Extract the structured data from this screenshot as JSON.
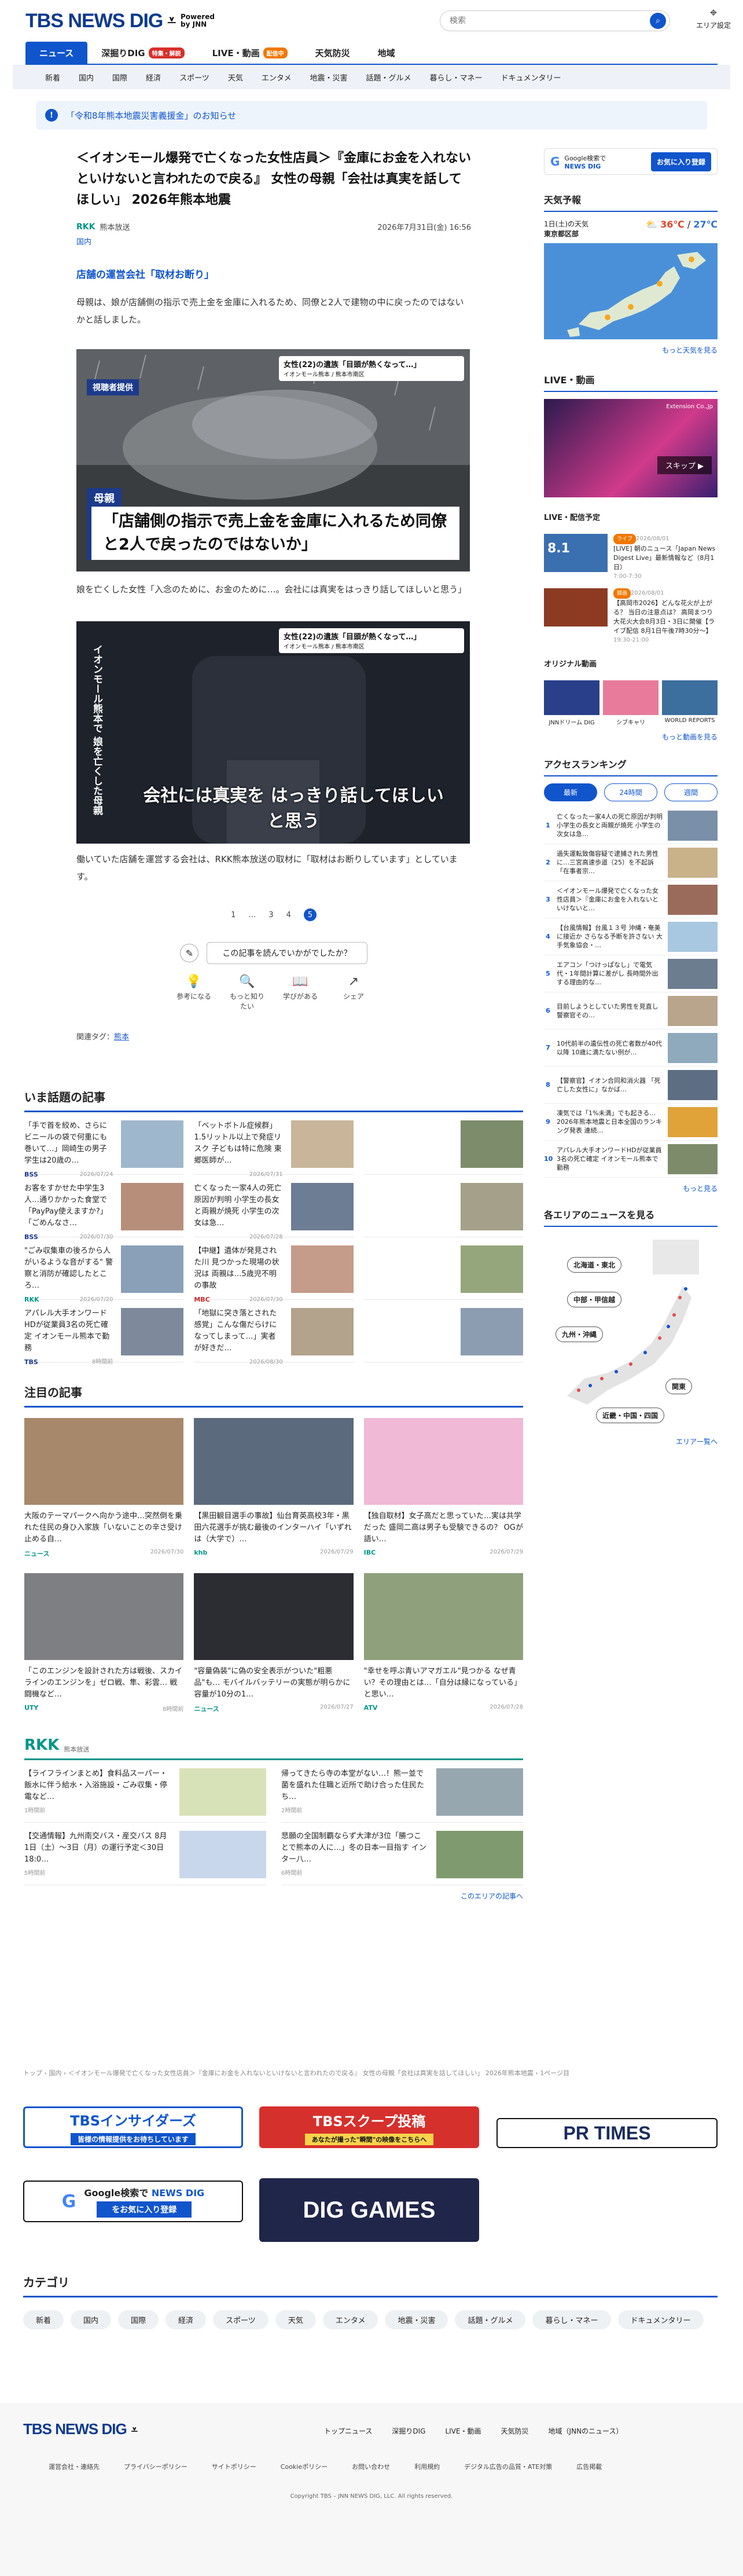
{
  "header": {
    "logo": "TBS NEWS DIG",
    "logo_powered": "Powered",
    "logo_by": "by JNN",
    "search_placeholder": "検索",
    "area_label": "エリア設定"
  },
  "gnav": [
    {
      "label": "ニュース",
      "badge": ""
    },
    {
      "label": "深掘りDIG",
      "badge": "特集・解説"
    },
    {
      "label": "LIVE・動画",
      "badge": "配信中"
    },
    {
      "label": "天気防災",
      "badge": ""
    },
    {
      "label": "地域",
      "badge": ""
    }
  ],
  "subnav": [
    "新着",
    "国内",
    "国際",
    "経済",
    "スポーツ",
    "天気",
    "エンタメ",
    "地震・災害",
    "話題・グルメ",
    "暮らし・マネー",
    "ドキュメンタリー"
  ],
  "alert": {
    "icon": "!",
    "text": "「令和8年熊本地震災害義援金」のお知らせ"
  },
  "article": {
    "title": "＜イオンモール爆発で亡くなった女性店員＞『金庫にお金を入れないといけないと言われたので戻る』 女性の母親「会社は真実を話してほしい」 2026年熊本地震",
    "source": "熊本放送",
    "source_logo": "RKK",
    "date": "2026年7月31日(金) 16:56",
    "category": "国内",
    "lead": "店舗の運営会社「取材お断り」",
    "p1": "母親は、娘が店舗側の指示で売上金を金庫に入れるため、同僚と2人で建物の中に戻ったのではないかと話しました。",
    "photo1": {
      "caption": "女性(22)の遺族「目頭が熱くなって…」",
      "caption_sub": "イオンモール熊本 / 熊本市南区",
      "tag": "視聴者提供",
      "tel": "母親",
      "band": "「店舗側の指示で売上金を金庫に入れるため同僚と2人で戻ったのではないか」"
    },
    "p2": "娘を亡くした女性「入念のために、お金のために…。会社には真実をはっきり話してほしいと思う」",
    "photo2": {
      "caption": "女性(22)の遺族「目頭が熱くなって…」",
      "caption_sub": "イオンモール熊本 / 熊本市南区",
      "vert": "イオンモール熊本で 娘を亡くした母親",
      "sub": "会社には真実を はっきり話してほしいと思う"
    },
    "p3": "働いていた店舗を運営する会社は、RKK熊本放送の取材に「取材はお断りしています」としています。",
    "pager": [
      "1",
      "…",
      "3",
      "4",
      "5"
    ],
    "react_q": "この記事を読んでいかがでしたか？",
    "reacts": [
      {
        "icon": "💡",
        "label": "参考になる"
      },
      {
        "icon": "🔍",
        "label": "もっと知りたい"
      },
      {
        "icon": "📖",
        "label": "学びがある"
      },
      {
        "icon": "↗",
        "label": "シェア"
      }
    ],
    "tags_label": "関連タグ：",
    "tag": "熊本"
  },
  "hot": {
    "title": "いま話題の記事",
    "items": [
      {
        "text": "「手で首を絞め、さらにビニールの袋で何重にも巻いて…」岡崎生の男子学生は20歳の…",
        "src": "BSS",
        "time": "2026/07/24"
      },
      {
        "text": "「ベットボトル症候群」1.5リットル以上で発症リスク 子どもは特に危険 東郷医師が…",
        "src": "",
        "time": "2026/07/31"
      },
      {
        "text": "",
        "src": "",
        "time": ""
      },
      {
        "text": "お客をすかせた中学生3人…通りかかった食堂で「PayPay使えますか?」「ごめんなさ…",
        "src": "BSS",
        "time": "2026/07/30"
      },
      {
        "text": "亡くなった一家4人の死亡原因が判明 小学生の長女と両親が焼死 小学生の次女は急…",
        "src": "",
        "time": "2026/07/28"
      },
      {
        "text": "",
        "src": "",
        "time": ""
      },
      {
        "text": "\"ごみ収集車の後ろから人がいるような音がする\" 警察と消防が確認したところ…",
        "src": "RKK",
        "time": "2026/07/20"
      },
      {
        "text": "【中継】遺体が発見された川 見つかった現場の状況は 両親は…5歳児不明の事故",
        "src": "MBC",
        "time": "2026/07/30"
      },
      {
        "text": "",
        "src": "",
        "time": ""
      },
      {
        "text": "アパレル大手オンワードHDが従業員3名の死亡確定 イオンモール熊本で勤務",
        "src": "TBS",
        "time": "8時間前"
      },
      {
        "text": "「地獄に突き落とされた感覚」こんな傷だらけになってしまって…」実者が好きだ…",
        "src": "",
        "time": "2026/08/30"
      },
      {
        "text": "",
        "src": "",
        "time": ""
      }
    ]
  },
  "featured": {
    "title": "注目の記事",
    "items": [
      {
        "text": "大阪のテーマパークへ向かう途中…突然倒を乗れた住民の身ひ入家族「いないことの辛さ受け止める自…",
        "src": "ニュース",
        "time": "2026/07/30"
      },
      {
        "text": "【黒田観目選手の事故】仙台育英高校3年・黒田六花選手が挑む最後のインターハイ「いずれは（大学で）…",
        "src": "khb",
        "time": "2026/07/29"
      },
      {
        "text": "【独自取材】女子高だと思っていた…実は共学だった 盛岡二高は男子も受験できるの？ OGが語い…",
        "src": "IBC",
        "time": "2026/07/29"
      },
      {
        "text": "「このエンジンを設計された方は戦後、スカイラインのエンジンを」ゼロ戦、隼、彩雲… 戦闘機など…",
        "src": "UTY",
        "time": "8時間前"
      },
      {
        "text": "\"容量偽装\"に偽の安全表示がついた\"粗悪品\"も… モバイルバッテリーの実態が明らかに 容量が10分の1…",
        "src": "ニュース",
        "time": "2026/07/27"
      },
      {
        "text": "\"幸せを呼ぶ青いアマガエル\"見つかる なぜ青い？その理由とは…「自分は縁になっている」と思い…",
        "src": "ATV",
        "time": "2026/07/28"
      }
    ]
  },
  "local": {
    "logo": "RKK",
    "sub": "熊本放送",
    "items": [
      {
        "text": "【ライフラインまとめ】食料品スーパー・飯水に伴う給水・入浴施設・ごみ収集・停電など…",
        "time": "1時間前"
      },
      {
        "text": "帰ってきたら寺の本堂がない…！熊一並で菌を盛れた住職と近所で助け合った住民たち…",
        "time": "2時間前"
      },
      {
        "text": "【交通情報】九州南交バス・産交バス 8月1日（土）～3日（月）の運行予定＜30日18:0…",
        "time": "5時間前"
      },
      {
        "text": "悲願の全国制覇ならず大津が3位「勝つことで熊本の人に…」冬の日本一目指す インター八…",
        "time": "6時間前"
      }
    ],
    "more": "このエリアの記事へ"
  },
  "breadcrumb": "トップ › 国内 › ＜イオンモール爆発で亡くなった女性店員＞『金庫にお金を入れないといけないと言われたので戻る』 女性の母親「会社は真実を話してほしい」 2026年熊本地震 › 1ページ目",
  "banners": {
    "insiders": "TBSインサイダーズ",
    "insiders_sub": "皆様の情報提供をお待ちしています",
    "scoop": "TBSスクープ投稿",
    "scoop_sub": "あなたが撮った\"瞬間\"の映像をこちらへ",
    "prtimes": "PR TIMES",
    "google": "Google検索で",
    "google_brand": "NEWS DIG",
    "google_btn": "をお気に入り登録",
    "games": "DIG GAMES"
  },
  "sidebar": {
    "google_text": "Google検索で",
    "google_brand": "NEWS DIG",
    "google_btn": "お気に入り登録",
    "weather_title": "天気予報",
    "weather_day": "1日(土)の天気",
    "weather_area": "東京都区部",
    "weather_high": "36℃",
    "weather_low": "27℃",
    "weather_more": "もっと天気を見る",
    "live_title": "LIVE・動画",
    "live_ad": "Extension Co.,Jp",
    "live_skip": "スキップ ▶",
    "sched_title": "LIVE・配信予定",
    "sched": [
      {
        "badge": "ライブ",
        "date": "2026/08/01",
        "time": "8.1",
        "text": "[LIVE] 朝のニュース「Japan News Digest Live」最新情報など（8月1日）",
        "clock": "7:00-7:30"
      },
      {
        "badge": "録画",
        "date": "2026/08/01",
        "time": "",
        "text": "【高岡市2026】どんな花火が上がる？ 当日の注意点は？ 高岡まつり大花火大会8月3日・3日に開催【ライブ配信 8月1日午後7時30分〜】",
        "clock": "19:30-21:00"
      }
    ],
    "orig_title": "オリジナル動画",
    "orig": [
      "JNNドリーム DIG",
      "シブキャリ",
      "WORLD REPORTS"
    ],
    "orig_more": "もっと動画を見る",
    "rank_title": "アクセスランキング",
    "rank_tabs": [
      "最新",
      "24時間",
      "週間"
    ],
    "rank": [
      {
        "n": "1",
        "t": "亡くなった一家4人の死亡原因が判明 小学生の長女と両親が焼死 小学生の次女は急…"
      },
      {
        "n": "2",
        "t": "過失運転致傷容疑で逮捕された男性に…三宮高速歩道（25）を不起訴「在事者宗…"
      },
      {
        "n": "3",
        "t": "＜イオンモール爆発で亡くなった女性店員＞『金庫にお金を入れないといけないと…"
      },
      {
        "n": "4",
        "t": "【台風情報】台風１３号 沖縄・奄美に接近か さらなる予断を許さない 大手気象協会・…"
      },
      {
        "n": "5",
        "t": "エアコン「つけっぱなし」で電気代・1年間計算に差がし 長時間外出する理由的な…"
      },
      {
        "n": "6",
        "t": "目前しようとしていた男性を見直し警察官その…"
      },
      {
        "n": "7",
        "t": "10代前半の遺伝性の死亡者数が40代以降 10歳に満たない例が…"
      },
      {
        "n": "8",
        "t": "【警察官】イオン合同和消火器 「死亡した女性に」なかば…"
      },
      {
        "n": "9",
        "t": "凍気では「1%未満」でも起きる…2026年熊本地震と日本全国のランキング発表 連続…"
      },
      {
        "n": "10",
        "t": "アパレル大手オンワードHDが従業員3名の死亡確定 イオンモール熊本で勤務"
      }
    ],
    "rank_more": "もっと見る",
    "area_title": "各エリアのニュースを見る",
    "areas": [
      "北海道・東北",
      "中部・甲信越",
      "九州・沖縄",
      "関東",
      "近畿・中国・四国"
    ],
    "area_more": "エリア一覧へ"
  },
  "categories": {
    "title": "カテゴリ",
    "items": [
      "新着",
      "国内",
      "国際",
      "経済",
      "スポーツ",
      "天気",
      "エンタメ",
      "地震・災害",
      "話題・グルメ",
      "暮らし・マネー",
      "ドキュメンタリー"
    ]
  },
  "footer": {
    "logo": "TBS NEWS DIG",
    "links1": [
      "トップニュース",
      "深掘りDIG",
      "LIVE・動画",
      "天気防災",
      "地域（JNNのニュース）"
    ],
    "links2": [
      "運営会社・連絡先",
      "プライバシーポリシー",
      "サイトポリシー",
      "Cookieポリシー",
      "お問い合わせ",
      "利用規約",
      "デジタル広告の品質・ATE対策",
      "広告掲載"
    ],
    "copyright": "Copyright TBS – JNN NEWS DIG, LLC. All rights reserved."
  },
  "colors": {
    "brand": "#1155cc",
    "accent": "#d6302c",
    "live": "#f07800"
  }
}
